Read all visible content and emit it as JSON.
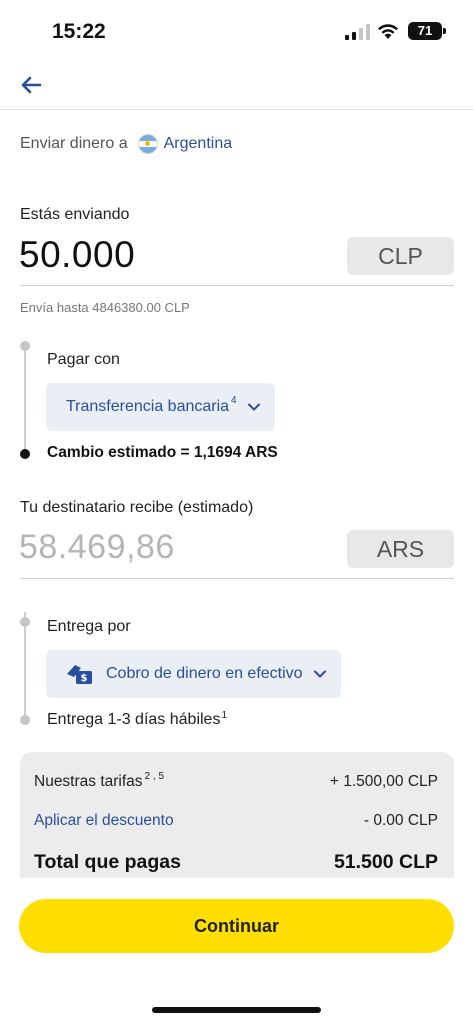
{
  "status_bar": {
    "time": "15:22",
    "battery": "71"
  },
  "header": {
    "send_to_label": "Enviar dinero a",
    "country": "Argentina"
  },
  "send": {
    "label": "Estás enviando",
    "amount": "50.000",
    "currency": "CLP",
    "limit_hint": "Envía hasta 4846380.00 CLP"
  },
  "payment": {
    "label": "Pagar con",
    "method": "Transferencia bancaria",
    "method_note": "4",
    "rate_text": "Cambio estimado =  1,1694 ARS"
  },
  "receive": {
    "label": "Tu destinatario recibe (estimado)",
    "amount": "58.469,86",
    "currency": "ARS"
  },
  "delivery": {
    "label": "Entrega por",
    "method": "Cobro de dinero en efectivo",
    "time_text": "Entrega 1-3 días hábiles",
    "time_note": "1"
  },
  "fees": {
    "fee_label": "Nuestras tarifas",
    "fee_notes": "2 , 5",
    "fee_value": "+ 1.500,00 CLP",
    "discount_label": "Aplicar el descuento",
    "discount_value": "- 0.00 CLP",
    "total_label": "Total que pagas",
    "total_value": "51.500 CLP"
  },
  "actions": {
    "continue_label": "Continuar"
  },
  "colors": {
    "accent_blue": "#2a4e9c",
    "button_yellow": "#ffde00"
  }
}
